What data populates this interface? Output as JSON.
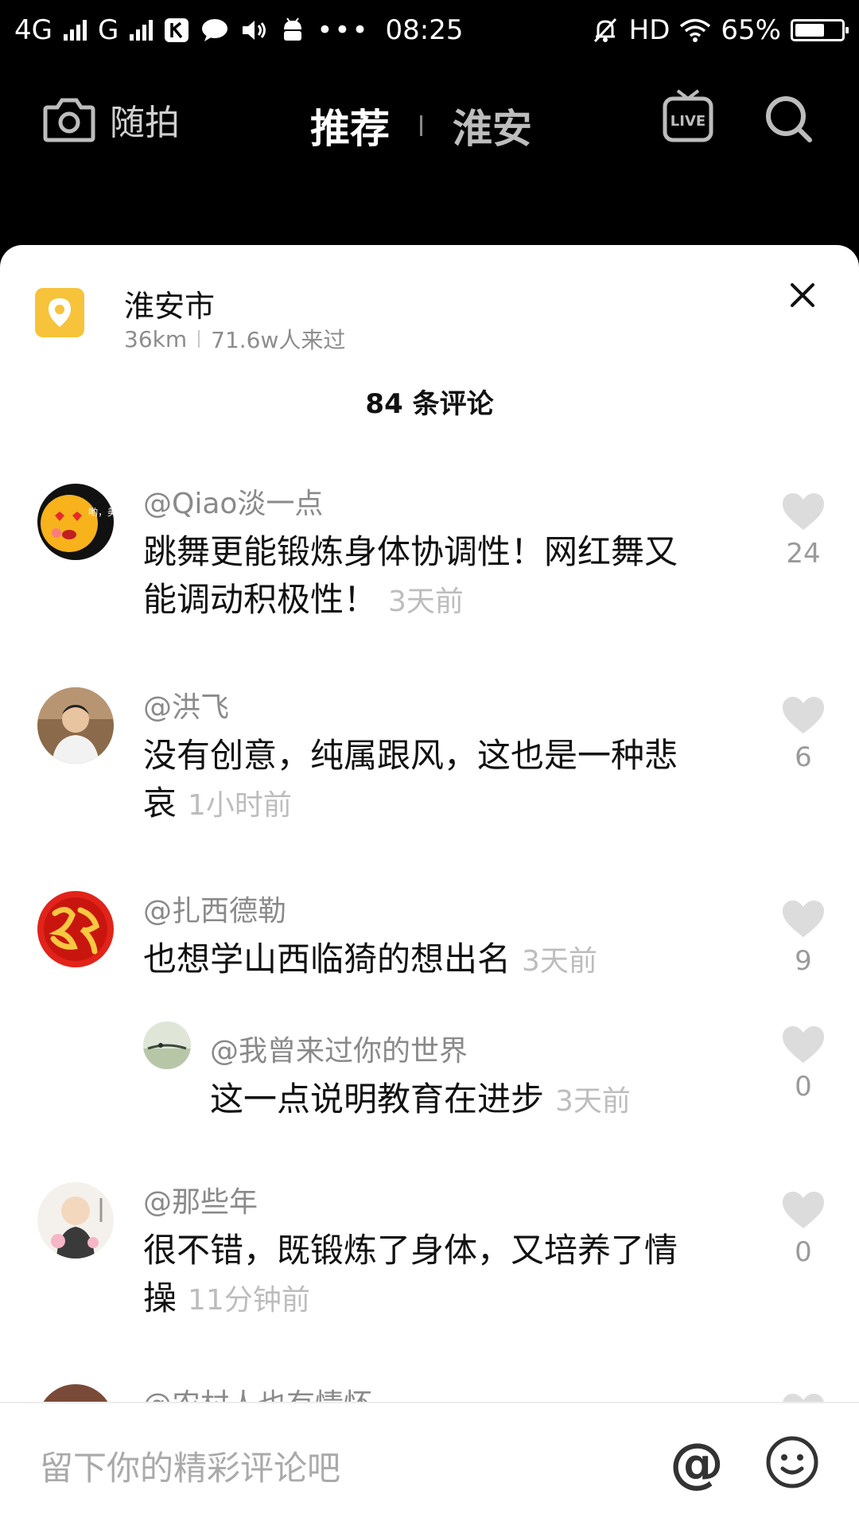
{
  "status_bar": {
    "network_left": "4G",
    "network_right": "G",
    "time": "08:25",
    "hd": "HD",
    "battery": "65%",
    "battery_level": 0.65
  },
  "top_nav": {
    "camera_label": "随拍",
    "tab_recommend": "推荐",
    "tab_local": "淮安",
    "live_label": "LIVE"
  },
  "location": {
    "name": "淮安市",
    "distance": "36km",
    "visitors": "71.6w人来过"
  },
  "comments_header": {
    "title": "84 条评论"
  },
  "comments": [
    {
      "user": "@Qiao淡一点",
      "text": "跳舞更能锻炼身体协调性！网红舞又能调动积极性！",
      "time": "3天前",
      "likes": "24",
      "avatar_text": "哟，美"
    },
    {
      "user": "@洪飞",
      "text": "没有创意，纯属跟风，这也是一种悲哀",
      "time": "1小时前",
      "likes": "6"
    },
    {
      "user": "@扎西德勒",
      "text": "也想学山西临猗的想出名",
      "time": "3天前",
      "likes": "9"
    },
    {
      "user": "@我曾来过你的世界",
      "text": "这一点说明教育在进步",
      "time": "3天前",
      "likes": "0"
    },
    {
      "user": "@那些年",
      "text": "很不错，既锻炼了身体，又培养了情操",
      "time": "11分钟前",
      "likes": "0"
    },
    {
      "user": "@农村人也有情怀"
    }
  ],
  "input_bar": {
    "placeholder": "留下你的精彩评论吧",
    "at_label": "@"
  },
  "colors": {
    "accent_yellow": "#f7c33b",
    "like_gray": "#dcdcdc"
  }
}
